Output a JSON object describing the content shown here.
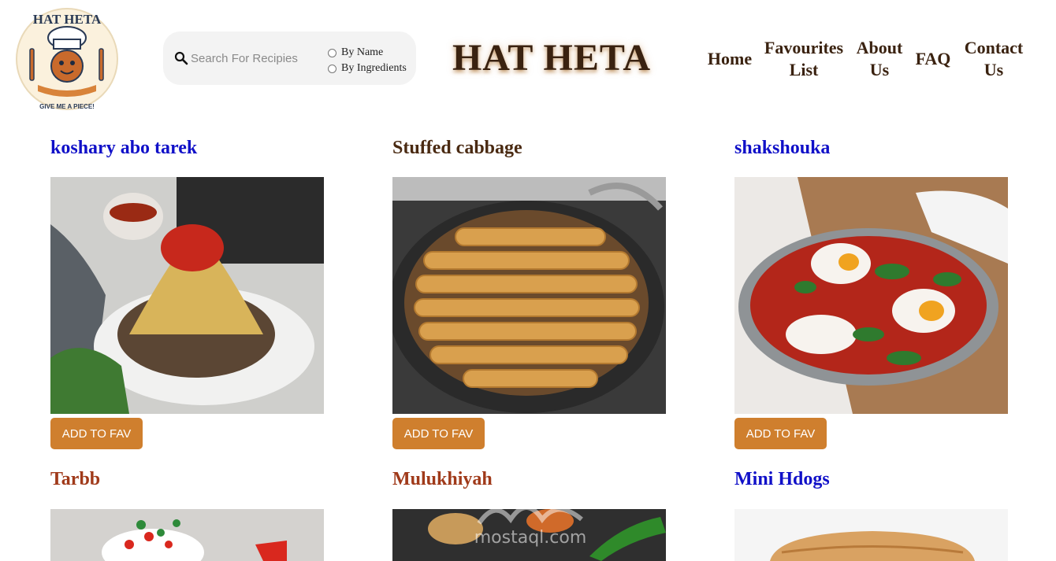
{
  "brand": {
    "logo_text_top": "HAT HETA",
    "logo_text_bottom": "GIVE ME A PIECE!",
    "site_title": "HAT HETA"
  },
  "search": {
    "placeholder": "Search For Recipies",
    "options": [
      "By Name",
      "By Ingredients"
    ]
  },
  "nav": {
    "home": "Home",
    "favourites_line1": "Favourites",
    "favourites_line2": "List",
    "about_line1": "About",
    "about_line2": "Us",
    "faq": "FAQ",
    "contact_line1": "Contact",
    "contact_line2": "Us"
  },
  "recipes": [
    {
      "title": "koshary abo tarek",
      "title_color": "#1010c8",
      "button": "ADD TO FAV"
    },
    {
      "title": "Stuffed cabbage",
      "title_color": "#4a2a12",
      "button": "ADD TO FAV"
    },
    {
      "title": "shakshouka",
      "title_color": "#1010c8",
      "button": "ADD TO FAV"
    },
    {
      "title": "Tarbb",
      "title_color": "#a03a1a"
    },
    {
      "title": "Mulukhiyah",
      "title_color": "#a03a1a"
    },
    {
      "title": "Mini Hdogs",
      "title_color": "#1010c8"
    }
  ],
  "colors": {
    "accent_button": "#cf7f2e",
    "heading_brown": "#3a2210"
  },
  "watermark": "mostaql.com"
}
